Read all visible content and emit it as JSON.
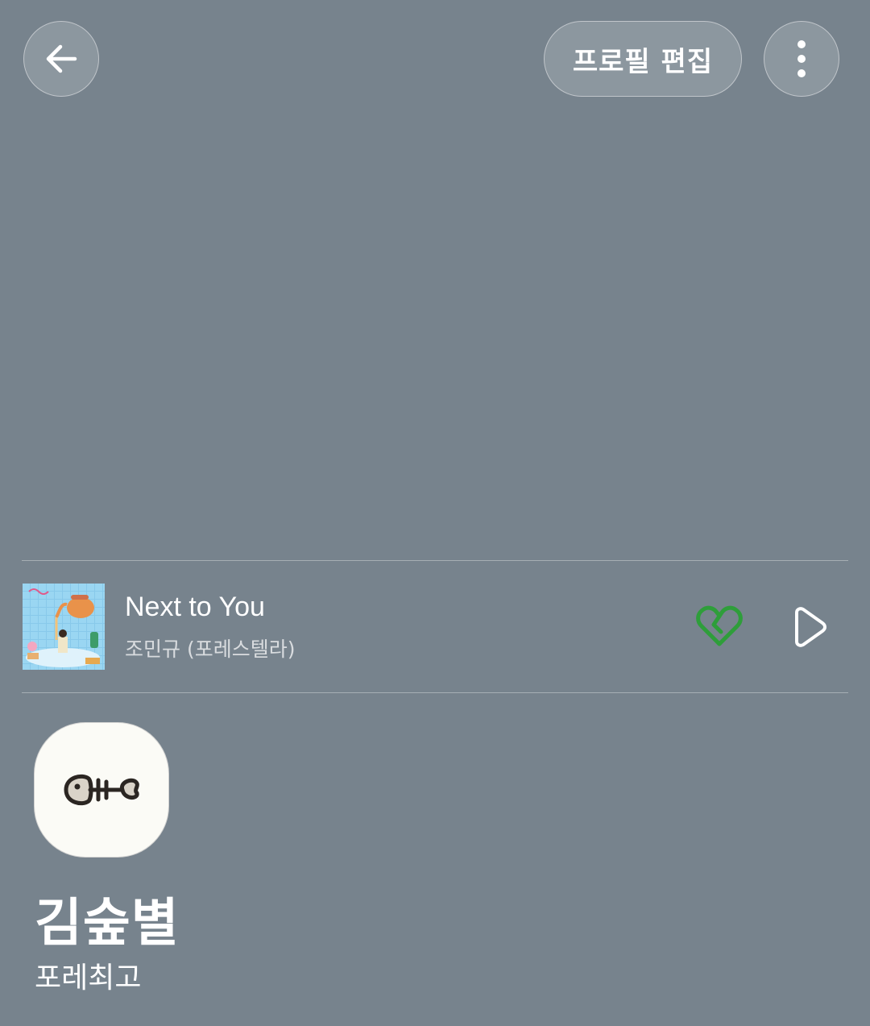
{
  "header": {
    "back_icon": "arrow-left-icon",
    "edit_profile_label": "프로필 편집",
    "more_icon": "more-vertical-icon"
  },
  "music": {
    "song_title": "Next to You",
    "artist": "조민규 (포레스텔라)",
    "like_icon": "heart-broken-icon",
    "like_color": "#2e9e3a",
    "play_icon": "play-icon"
  },
  "profile": {
    "avatar_icon": "fish-bone-icon",
    "name": "김숲별",
    "status_message": "포레최고"
  },
  "colors": {
    "background": "#77838d",
    "text": "#ffffff",
    "accent_green": "#2e9e3a"
  }
}
